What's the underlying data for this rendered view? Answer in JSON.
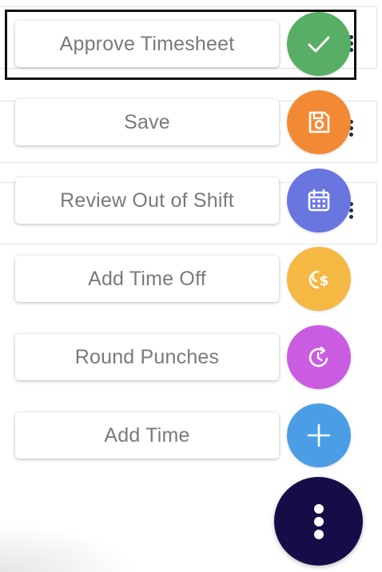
{
  "colors": {
    "approve": "#57ae64",
    "save": "#f28a35",
    "review": "#6976e0",
    "time_off": "#f4b843",
    "round": "#c95ce0",
    "add_time": "#4b9ee6",
    "main_fab": "#150d47"
  },
  "actions": [
    {
      "label": "Approve Timesheet",
      "icon": "check-icon"
    },
    {
      "label": "Save",
      "icon": "save-icon"
    },
    {
      "label": "Review Out of Shift",
      "icon": "calendar-icon"
    },
    {
      "label": "Add Time Off",
      "icon": "clock-dollar-icon"
    },
    {
      "label": "Round Punches",
      "icon": "clock-refresh-icon"
    },
    {
      "label": "Add Time",
      "icon": "plus-icon"
    }
  ],
  "main_fab": {
    "icon": "kebab-menu-icon"
  }
}
